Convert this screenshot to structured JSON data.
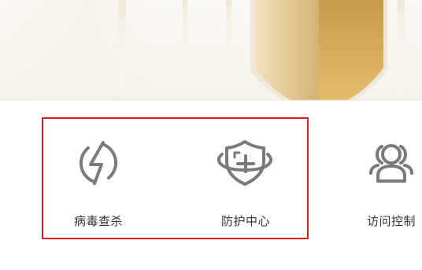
{
  "features": [
    {
      "label": "病毒查杀",
      "icon": "lightning-circle-icon"
    },
    {
      "label": "防护中心",
      "icon": "shield-plus-orbit-icon"
    },
    {
      "label": "访问控制",
      "icon": "users-icon"
    }
  ],
  "colors": {
    "icon_gray": "#7a7a7a",
    "text": "#333333",
    "highlight_red": "#e0191b",
    "gold_light": "#e7c98c",
    "gold_dark": "#c79b4b"
  }
}
